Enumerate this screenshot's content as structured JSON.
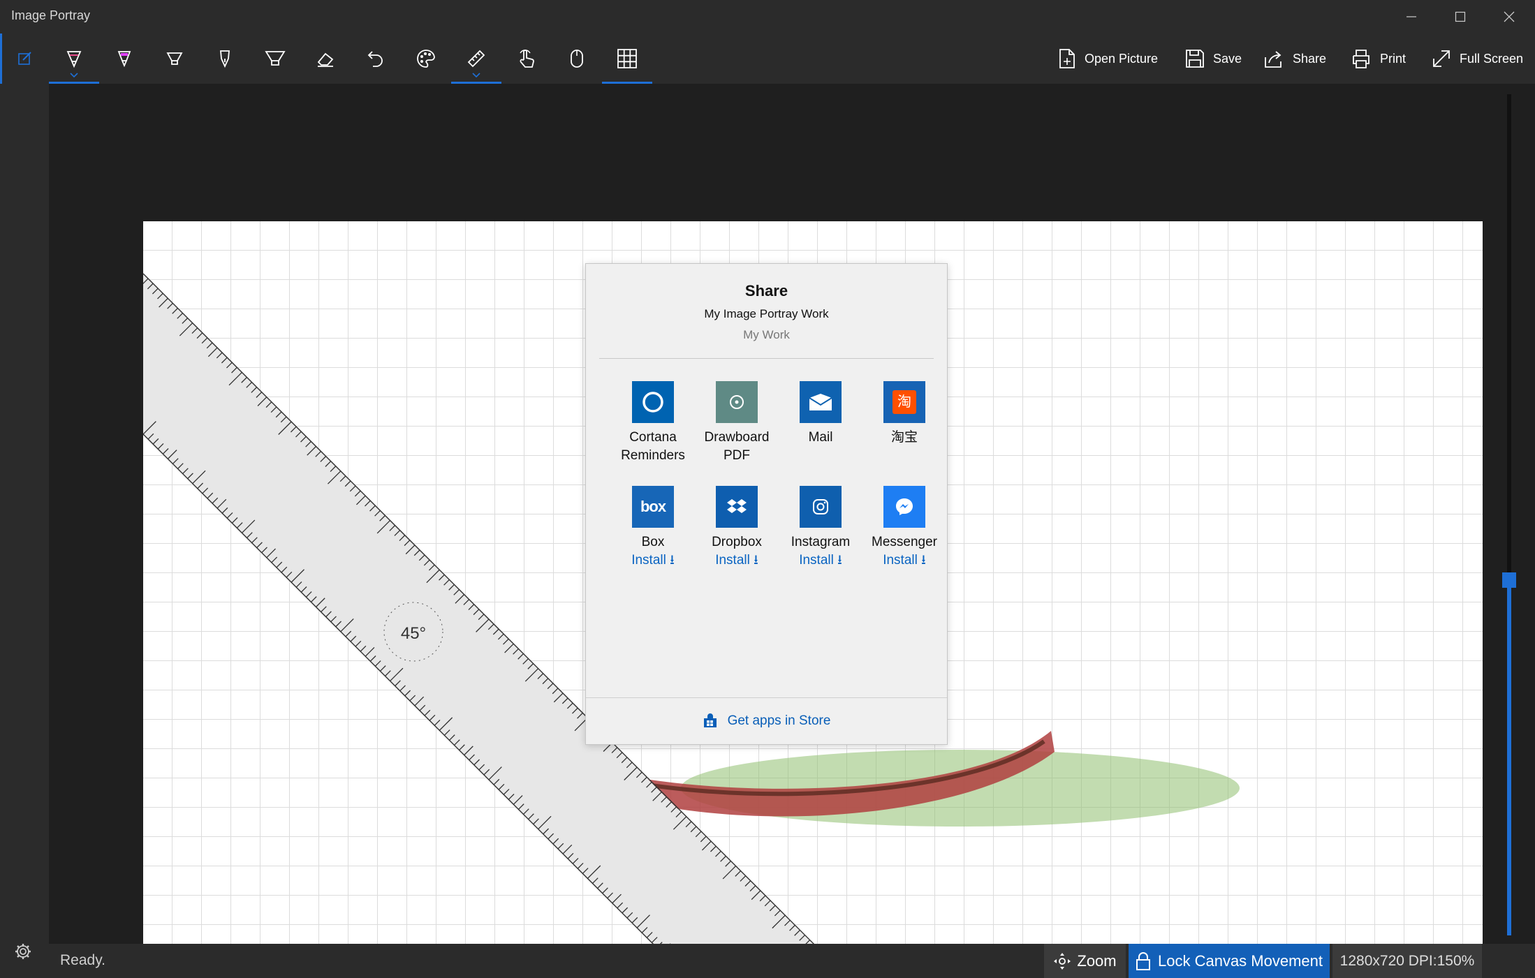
{
  "window": {
    "title": "Image Portray"
  },
  "toolbar": {
    "tools": [
      {
        "name": "edit-mode-icon",
        "active": true
      },
      {
        "name": "ballpoint-pen-icon",
        "selected": true,
        "chevron": true
      },
      {
        "name": "highlighter-pink-icon"
      },
      {
        "name": "pencil-icon"
      },
      {
        "name": "fountain-pen-icon"
      },
      {
        "name": "calligraphy-pen-icon"
      },
      {
        "name": "eraser-icon"
      },
      {
        "name": "undo-icon"
      },
      {
        "name": "palette-icon"
      },
      {
        "name": "ruler-icon",
        "selected": true,
        "chevron": true
      },
      {
        "name": "touch-writing-icon"
      },
      {
        "name": "mouse-icon"
      },
      {
        "name": "grid-icon",
        "selected": true
      }
    ],
    "commands": {
      "open": "Open Picture",
      "save": "Save",
      "share": "Share",
      "print": "Print",
      "fullscreen": "Full Screen"
    }
  },
  "ruler": {
    "angle_label": "45°"
  },
  "share_dialog": {
    "title": "Share",
    "subtitle": "My Image Portray Work",
    "description": "My Work",
    "apps": [
      {
        "name": "Cortana\nReminders",
        "line1": "Cortana",
        "line2": "Reminders",
        "install": "",
        "color": "#0063b1",
        "icon": "cortana-icon"
      },
      {
        "name": "Drawboard PDF",
        "line1": "Drawboard",
        "line2": "PDF",
        "install": "",
        "color": "#5f8a85",
        "icon": "drawboard-icon"
      },
      {
        "name": "Mail",
        "line1": "Mail",
        "line2": "",
        "install": "",
        "color": "#0f62b0",
        "icon": "mail-icon"
      },
      {
        "name": "淘宝",
        "line1": "淘宝",
        "line2": "",
        "install": "",
        "color": "#1763b4",
        "icon": "taobao-icon",
        "badge": "淘"
      },
      {
        "name": "Box",
        "line1": "Box",
        "line2": "",
        "install": "Install",
        "color": "#1766b7",
        "icon": "box-icon",
        "badge": "box"
      },
      {
        "name": "Dropbox",
        "line1": "Dropbox",
        "line2": "",
        "install": "Install",
        "color": "#0e5eaf",
        "icon": "dropbox-icon"
      },
      {
        "name": "Instagram",
        "line1": "Instagram",
        "line2": "",
        "install": "Install",
        "color": "#0f5fae",
        "icon": "instagram-icon"
      },
      {
        "name": "Messenger",
        "line1": "Messenger",
        "line2": "",
        "install": "Install",
        "color": "#1e7ef3",
        "icon": "messenger-icon"
      }
    ],
    "footer": "Get apps in Store"
  },
  "status": {
    "text": "Ready.",
    "zoom": "Zoom",
    "lock": "Lock Canvas Movement",
    "info": "1280x720 DPI:150%"
  },
  "zoom_slider": {
    "value_fraction": 0.4
  },
  "colors": {
    "accent": "#1e6fd6",
    "background": "#1f1f1f",
    "chrome": "#2b2b2b"
  }
}
